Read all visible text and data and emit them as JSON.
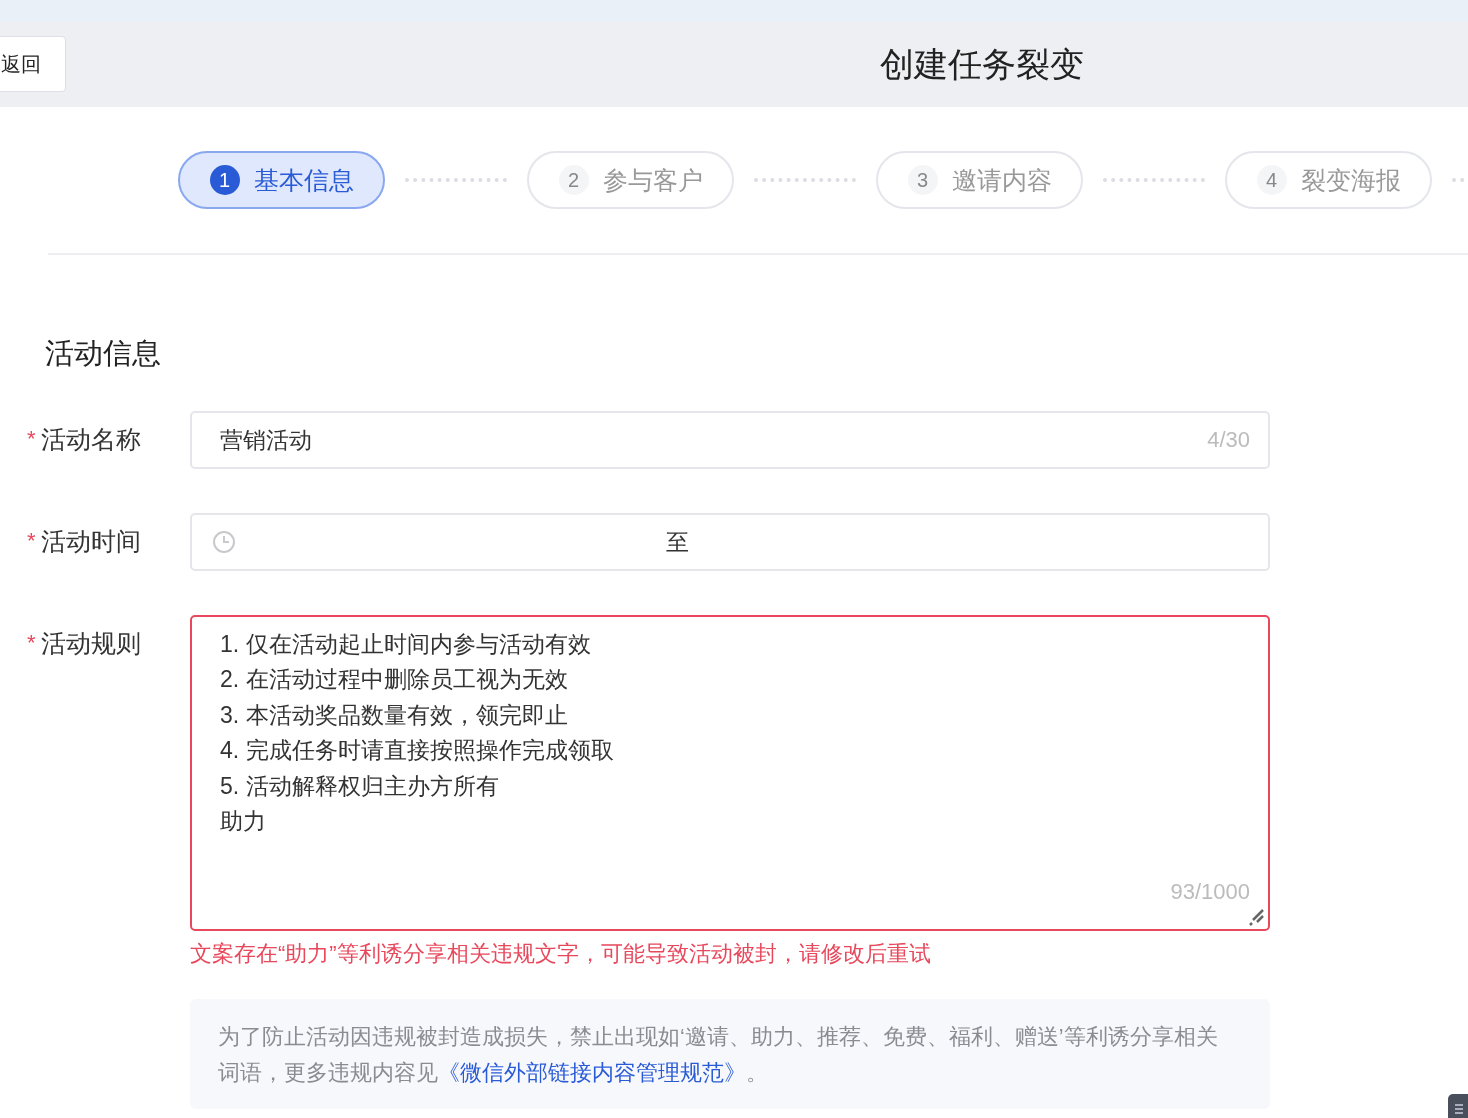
{
  "header": {
    "back_button": "返回",
    "title": "创建任务裂变"
  },
  "steps": [
    {
      "number": "1",
      "label": "基本信息",
      "selected": true
    },
    {
      "number": "2",
      "label": "参与客户",
      "selected": false
    },
    {
      "number": "3",
      "label": "邀请内容",
      "selected": false
    },
    {
      "number": "4",
      "label": "裂变海报",
      "selected": false
    }
  ],
  "section_title": "活动信息",
  "fields": [
    {
      "kind": "text",
      "label": "活动名称",
      "required_mark": "*",
      "value": "营销活动",
      "counter": "4/30"
    },
    {
      "kind": "daterange",
      "label": "活动时间",
      "required_mark": "*",
      "separator": "至"
    },
    {
      "kind": "textarea",
      "label": "活动规则",
      "required_mark": "*",
      "error": true,
      "lines": [
        "1. 仅在活动起止时间内参与活动有效",
        "2. 在活动过程中删除员工视为无效",
        "3. 本活动奖品数量有效，领完即止",
        "4. 完成任务时请直接按照操作完成领取",
        "5. 活动解释权归主办方所有",
        "助力"
      ],
      "counter": "93/1000",
      "error_message": "文案存在“助力”等利诱分享相关违规文字，可能导致活动被封，请修改后重试"
    }
  ],
  "notice": {
    "text": "为了防止活动因违规被封造成损失，禁止出现如‘邀请、助力、推荐、免费、福利、赠送’等利诱分享相关词语，更多违规内容见",
    "link": "《微信外部链接内容管理规范》",
    "end": "。"
  }
}
